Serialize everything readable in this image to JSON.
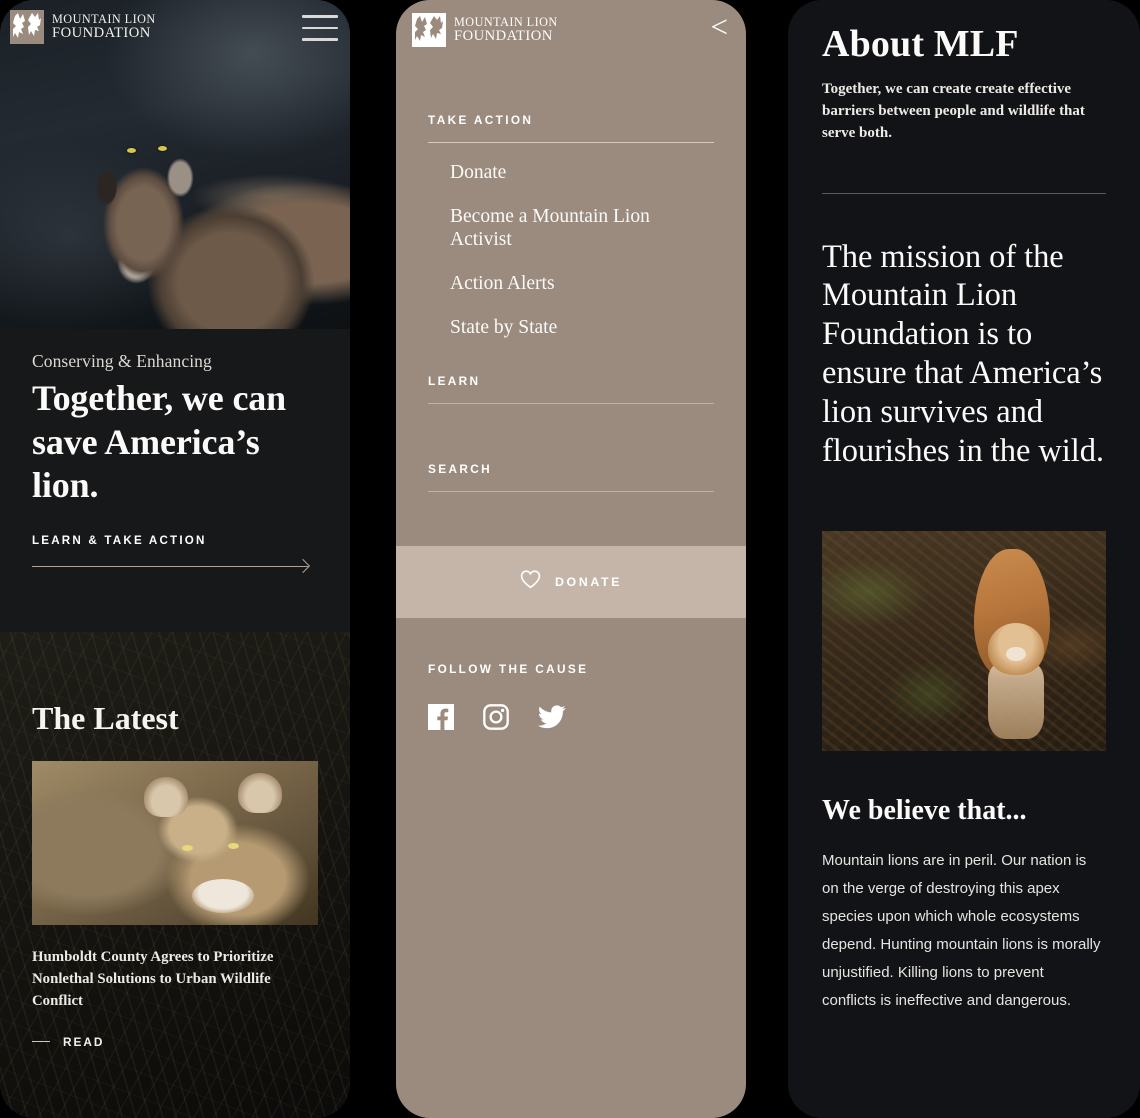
{
  "brand": {
    "line1": "MOUNTAIN LION",
    "line2": "FOUNDATION",
    "logo_icon": "lion-face-logo-icon"
  },
  "home_panel": {
    "menu_icon": "hamburger-menu-icon",
    "hero_image_alt": "mountain-lion-portrait-photo",
    "eyebrow": "Conserving & Enhancing",
    "headline": "Together, we can save America’s lion.",
    "cta_label": "LEARN & TAKE ACTION",
    "cta_icon": "arrow-right-icon",
    "latest": {
      "section_title": "The Latest",
      "card_image_alt": "resting-mountain-lion-photo",
      "headline": "Humboldt County Agrees to Prioritize Nonlethal Solutions to Urban Wildlife Conflict",
      "read_label": "READ",
      "read_icon": "dash-icon"
    }
  },
  "menu_panel": {
    "back_icon": "chevron-left-icon",
    "back_label": "<",
    "sections": [
      {
        "label": "TAKE ACTION",
        "links": [
          "Donate",
          "Become a Mountain Lion Activist",
          "Action Alerts",
          "State by State"
        ]
      },
      {
        "label": "LEARN",
        "links": []
      },
      {
        "label": "SEARCH",
        "links": []
      }
    ],
    "donate": {
      "label": "DONATE",
      "icon": "heart-icon",
      "background": "#c4b5a8"
    },
    "follow": {
      "label": "FOLLOW THE CAUSE",
      "socials": [
        {
          "name": "facebook-icon",
          "label": "Facebook"
        },
        {
          "name": "instagram-icon",
          "label": "Instagram"
        },
        {
          "name": "twitter-icon",
          "label": "Twitter"
        }
      ]
    },
    "background": "#9b8b7e"
  },
  "about_panel": {
    "title": "About MLF",
    "subtitle": "Together, we can create create effective barriers between people and wildlife that serve both.",
    "mission": "The mission of the Mountain Lion Foundation is to ensure that America’s lion survives and flourishes in the wild.",
    "image_alt": "mountain-lion-walking-in-forest-photo",
    "believe_title": "We believe that...",
    "believe_body": "Mountain lions are in peril. Our nation is on the verge of destroying this apex species upon which whole ecosystems depend. Hunting mountain lions is morally unjustified. Killing lions to prevent conflicts is ineffective and dangerous.",
    "background": "#121317"
  }
}
